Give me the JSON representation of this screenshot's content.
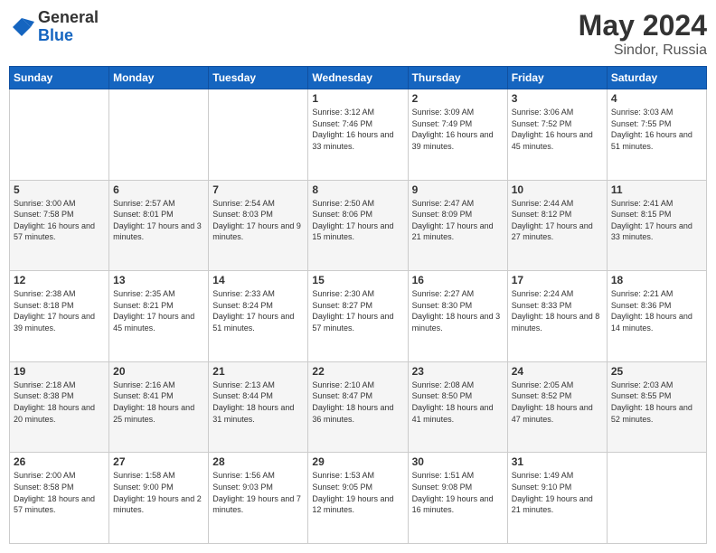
{
  "header": {
    "logo_general": "General",
    "logo_blue": "Blue",
    "title": "May 2024",
    "subtitle": "Sindor, Russia"
  },
  "days_of_week": [
    "Sunday",
    "Monday",
    "Tuesday",
    "Wednesday",
    "Thursday",
    "Friday",
    "Saturday"
  ],
  "weeks": [
    [
      {
        "day": "",
        "info": ""
      },
      {
        "day": "",
        "info": ""
      },
      {
        "day": "",
        "info": ""
      },
      {
        "day": "1",
        "info": "Sunrise: 3:12 AM\nSunset: 7:46 PM\nDaylight: 16 hours\nand 33 minutes."
      },
      {
        "day": "2",
        "info": "Sunrise: 3:09 AM\nSunset: 7:49 PM\nDaylight: 16 hours\nand 39 minutes."
      },
      {
        "day": "3",
        "info": "Sunrise: 3:06 AM\nSunset: 7:52 PM\nDaylight: 16 hours\nand 45 minutes."
      },
      {
        "day": "4",
        "info": "Sunrise: 3:03 AM\nSunset: 7:55 PM\nDaylight: 16 hours\nand 51 minutes."
      }
    ],
    [
      {
        "day": "5",
        "info": "Sunrise: 3:00 AM\nSunset: 7:58 PM\nDaylight: 16 hours\nand 57 minutes."
      },
      {
        "day": "6",
        "info": "Sunrise: 2:57 AM\nSunset: 8:01 PM\nDaylight: 17 hours\nand 3 minutes."
      },
      {
        "day": "7",
        "info": "Sunrise: 2:54 AM\nSunset: 8:03 PM\nDaylight: 17 hours\nand 9 minutes."
      },
      {
        "day": "8",
        "info": "Sunrise: 2:50 AM\nSunset: 8:06 PM\nDaylight: 17 hours\nand 15 minutes."
      },
      {
        "day": "9",
        "info": "Sunrise: 2:47 AM\nSunset: 8:09 PM\nDaylight: 17 hours\nand 21 minutes."
      },
      {
        "day": "10",
        "info": "Sunrise: 2:44 AM\nSunset: 8:12 PM\nDaylight: 17 hours\nand 27 minutes."
      },
      {
        "day": "11",
        "info": "Sunrise: 2:41 AM\nSunset: 8:15 PM\nDaylight: 17 hours\nand 33 minutes."
      }
    ],
    [
      {
        "day": "12",
        "info": "Sunrise: 2:38 AM\nSunset: 8:18 PM\nDaylight: 17 hours\nand 39 minutes."
      },
      {
        "day": "13",
        "info": "Sunrise: 2:35 AM\nSunset: 8:21 PM\nDaylight: 17 hours\nand 45 minutes."
      },
      {
        "day": "14",
        "info": "Sunrise: 2:33 AM\nSunset: 8:24 PM\nDaylight: 17 hours\nand 51 minutes."
      },
      {
        "day": "15",
        "info": "Sunrise: 2:30 AM\nSunset: 8:27 PM\nDaylight: 17 hours\nand 57 minutes."
      },
      {
        "day": "16",
        "info": "Sunrise: 2:27 AM\nSunset: 8:30 PM\nDaylight: 18 hours\nand 3 minutes."
      },
      {
        "day": "17",
        "info": "Sunrise: 2:24 AM\nSunset: 8:33 PM\nDaylight: 18 hours\nand 8 minutes."
      },
      {
        "day": "18",
        "info": "Sunrise: 2:21 AM\nSunset: 8:36 PM\nDaylight: 18 hours\nand 14 minutes."
      }
    ],
    [
      {
        "day": "19",
        "info": "Sunrise: 2:18 AM\nSunset: 8:38 PM\nDaylight: 18 hours\nand 20 minutes."
      },
      {
        "day": "20",
        "info": "Sunrise: 2:16 AM\nSunset: 8:41 PM\nDaylight: 18 hours\nand 25 minutes."
      },
      {
        "day": "21",
        "info": "Sunrise: 2:13 AM\nSunset: 8:44 PM\nDaylight: 18 hours\nand 31 minutes."
      },
      {
        "day": "22",
        "info": "Sunrise: 2:10 AM\nSunset: 8:47 PM\nDaylight: 18 hours\nand 36 minutes."
      },
      {
        "day": "23",
        "info": "Sunrise: 2:08 AM\nSunset: 8:50 PM\nDaylight: 18 hours\nand 41 minutes."
      },
      {
        "day": "24",
        "info": "Sunrise: 2:05 AM\nSunset: 8:52 PM\nDaylight: 18 hours\nand 47 minutes."
      },
      {
        "day": "25",
        "info": "Sunrise: 2:03 AM\nSunset: 8:55 PM\nDaylight: 18 hours\nand 52 minutes."
      }
    ],
    [
      {
        "day": "26",
        "info": "Sunrise: 2:00 AM\nSunset: 8:58 PM\nDaylight: 18 hours\nand 57 minutes."
      },
      {
        "day": "27",
        "info": "Sunrise: 1:58 AM\nSunset: 9:00 PM\nDaylight: 19 hours\nand 2 minutes."
      },
      {
        "day": "28",
        "info": "Sunrise: 1:56 AM\nSunset: 9:03 PM\nDaylight: 19 hours\nand 7 minutes."
      },
      {
        "day": "29",
        "info": "Sunrise: 1:53 AM\nSunset: 9:05 PM\nDaylight: 19 hours\nand 12 minutes."
      },
      {
        "day": "30",
        "info": "Sunrise: 1:51 AM\nSunset: 9:08 PM\nDaylight: 19 hours\nand 16 minutes."
      },
      {
        "day": "31",
        "info": "Sunrise: 1:49 AM\nSunset: 9:10 PM\nDaylight: 19 hours\nand 21 minutes."
      },
      {
        "day": "",
        "info": ""
      }
    ]
  ]
}
